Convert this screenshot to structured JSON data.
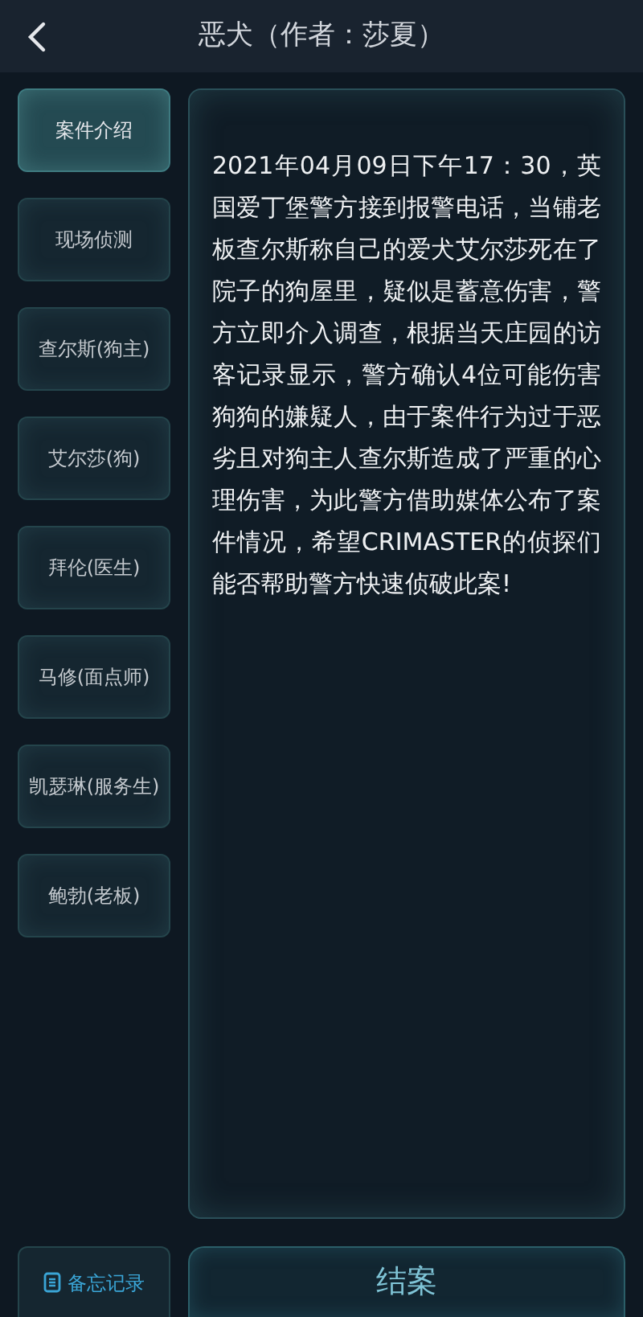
{
  "header": {
    "title": "恶犬（作者：莎夏）"
  },
  "sidebar": {
    "items": [
      {
        "label": "案件介绍",
        "selected": true
      },
      {
        "label": "现场侦测",
        "selected": false
      },
      {
        "label": "查尔斯(狗主)",
        "selected": false
      },
      {
        "label": "艾尔莎(狗)",
        "selected": false
      },
      {
        "label": "拜伦(医生)",
        "selected": false
      },
      {
        "label": "马修(面点师)",
        "selected": false
      },
      {
        "label": "凯瑟琳(服务生)",
        "selected": false
      },
      {
        "label": "鲍勃(老板)",
        "selected": false
      }
    ]
  },
  "content": {
    "text": "2021年04月09日下午17：30，英国爱丁堡警方接到报警电话，当铺老板查尔斯称自己的爱犬艾尔莎死在了院子的狗屋里，疑似是蓄意伤害，警方立即介入调查，根据当天庄园的访客记录显示，警方确认4位可能伤害狗狗的嫌疑人，由于案件行为过于恶劣且对狗主人查尔斯造成了严重的心理伤害，为此警方借助媒体公布了案件情况，希望CRIMASTER的侦探们能否帮助警方快速侦破此案!"
  },
  "footer": {
    "memo_button": "备忘记录",
    "close_case_button": "结案"
  }
}
